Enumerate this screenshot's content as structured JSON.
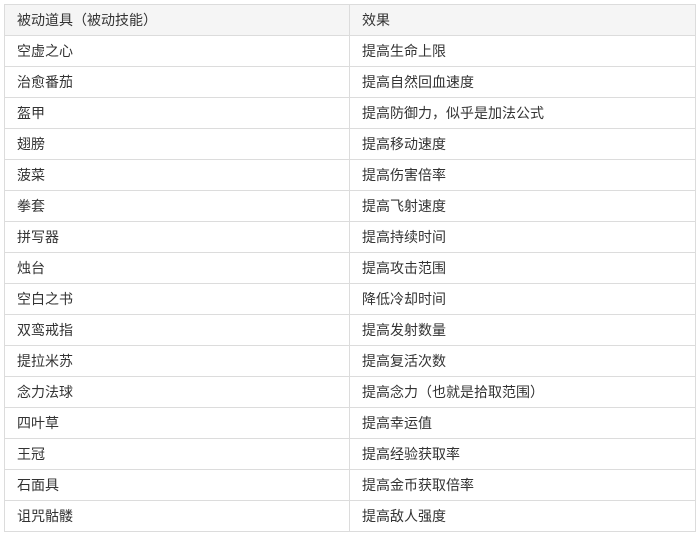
{
  "table": {
    "headers": [
      "被动道具（被动技能）",
      "效果"
    ],
    "rows": [
      {
        "item": "空虚之心",
        "effect": "提高生命上限"
      },
      {
        "item": "治愈番茄",
        "effect": "提高自然回血速度"
      },
      {
        "item": "盔甲",
        "effect": "提高防御力，似乎是加法公式"
      },
      {
        "item": "翅膀",
        "effect": "提高移动速度"
      },
      {
        "item": "菠菜",
        "effect": "提高伤害倍率"
      },
      {
        "item": "拳套",
        "effect": "提高飞射速度"
      },
      {
        "item": "拼写器",
        "effect": "提高持续时间"
      },
      {
        "item": "烛台",
        "effect": "提高攻击范围"
      },
      {
        "item": "空白之书",
        "effect": "降低冷却时间"
      },
      {
        "item": "双鸾戒指",
        "effect": "提高发射数量"
      },
      {
        "item": "提拉米苏",
        "effect": "提高复活次数"
      },
      {
        "item": "念力法球",
        "effect": "提高念力（也就是拾取范围）"
      },
      {
        "item": "四叶草",
        "effect": "提高幸运值"
      },
      {
        "item": "王冠",
        "effect": "提高经验获取率"
      },
      {
        "item": "石面具",
        "effect": "提高金币获取倍率"
      },
      {
        "item": "诅咒骷髅",
        "effect": "提高敌人强度"
      }
    ]
  }
}
